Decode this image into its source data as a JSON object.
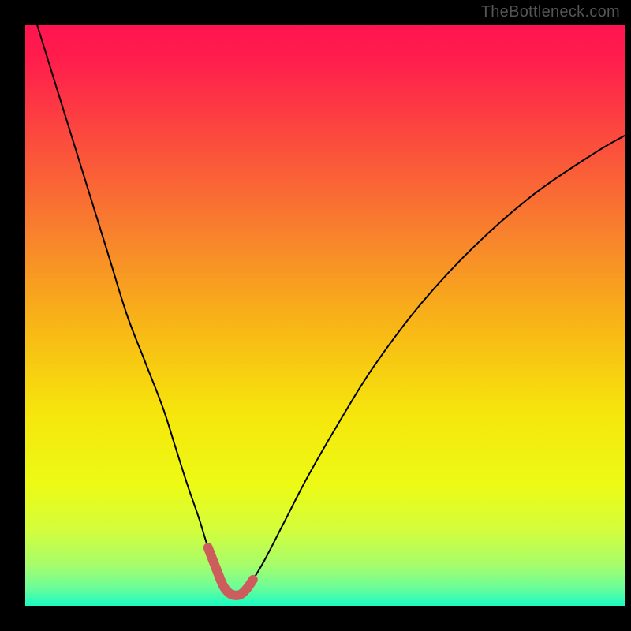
{
  "watermark": "TheBottleneck.com",
  "chart_data": {
    "type": "line",
    "title": "",
    "xlabel": "",
    "ylabel": "",
    "xlim": [
      0,
      100
    ],
    "ylim": [
      0,
      100
    ],
    "grid": false,
    "legend": false,
    "series": [
      {
        "name": "bottleneck-curve",
        "color": "#000000",
        "stroke_width": 2,
        "x": [
          2,
          5,
          8,
          11,
          14,
          17,
          20,
          23,
          25,
          27,
          29,
          30.5,
          32,
          33,
          34,
          35,
          36,
          37,
          38,
          40,
          43,
          47,
          52,
          58,
          66,
          75,
          85,
          95,
          100
        ],
        "values": [
          100,
          90,
          80,
          70,
          60,
          50,
          42,
          34,
          27.5,
          21,
          15,
          10,
          6,
          3.5,
          2.2,
          1.8,
          2.0,
          3.0,
          4.5,
          8,
          14,
          22,
          31,
          41,
          52,
          62,
          71,
          78,
          81
        ]
      },
      {
        "name": "optimum-band",
        "color": "#cd5c5c",
        "stroke_width": 12,
        "stroke_linecap": "round",
        "x": [
          30.5,
          32,
          33,
          34,
          35,
          36,
          37,
          38
        ],
        "values": [
          10,
          6,
          3.5,
          2.2,
          1.8,
          2.0,
          3.0,
          4.5
        ]
      }
    ],
    "background_gradient": {
      "type": "vertical",
      "stops": [
        {
          "pos": 0.0,
          "color": "#ff1450"
        },
        {
          "pos": 0.06,
          "color": "#ff1e4c"
        },
        {
          "pos": 0.21,
          "color": "#fb503c"
        },
        {
          "pos": 0.36,
          "color": "#f8822d"
        },
        {
          "pos": 0.52,
          "color": "#f8b716"
        },
        {
          "pos": 0.67,
          "color": "#f6e60c"
        },
        {
          "pos": 0.79,
          "color": "#edfa14"
        },
        {
          "pos": 0.87,
          "color": "#d3fd3c"
        },
        {
          "pos": 0.93,
          "color": "#a6fd6b"
        },
        {
          "pos": 0.97,
          "color": "#6afd9a"
        },
        {
          "pos": 1.0,
          "color": "#18fbc3"
        }
      ]
    }
  }
}
